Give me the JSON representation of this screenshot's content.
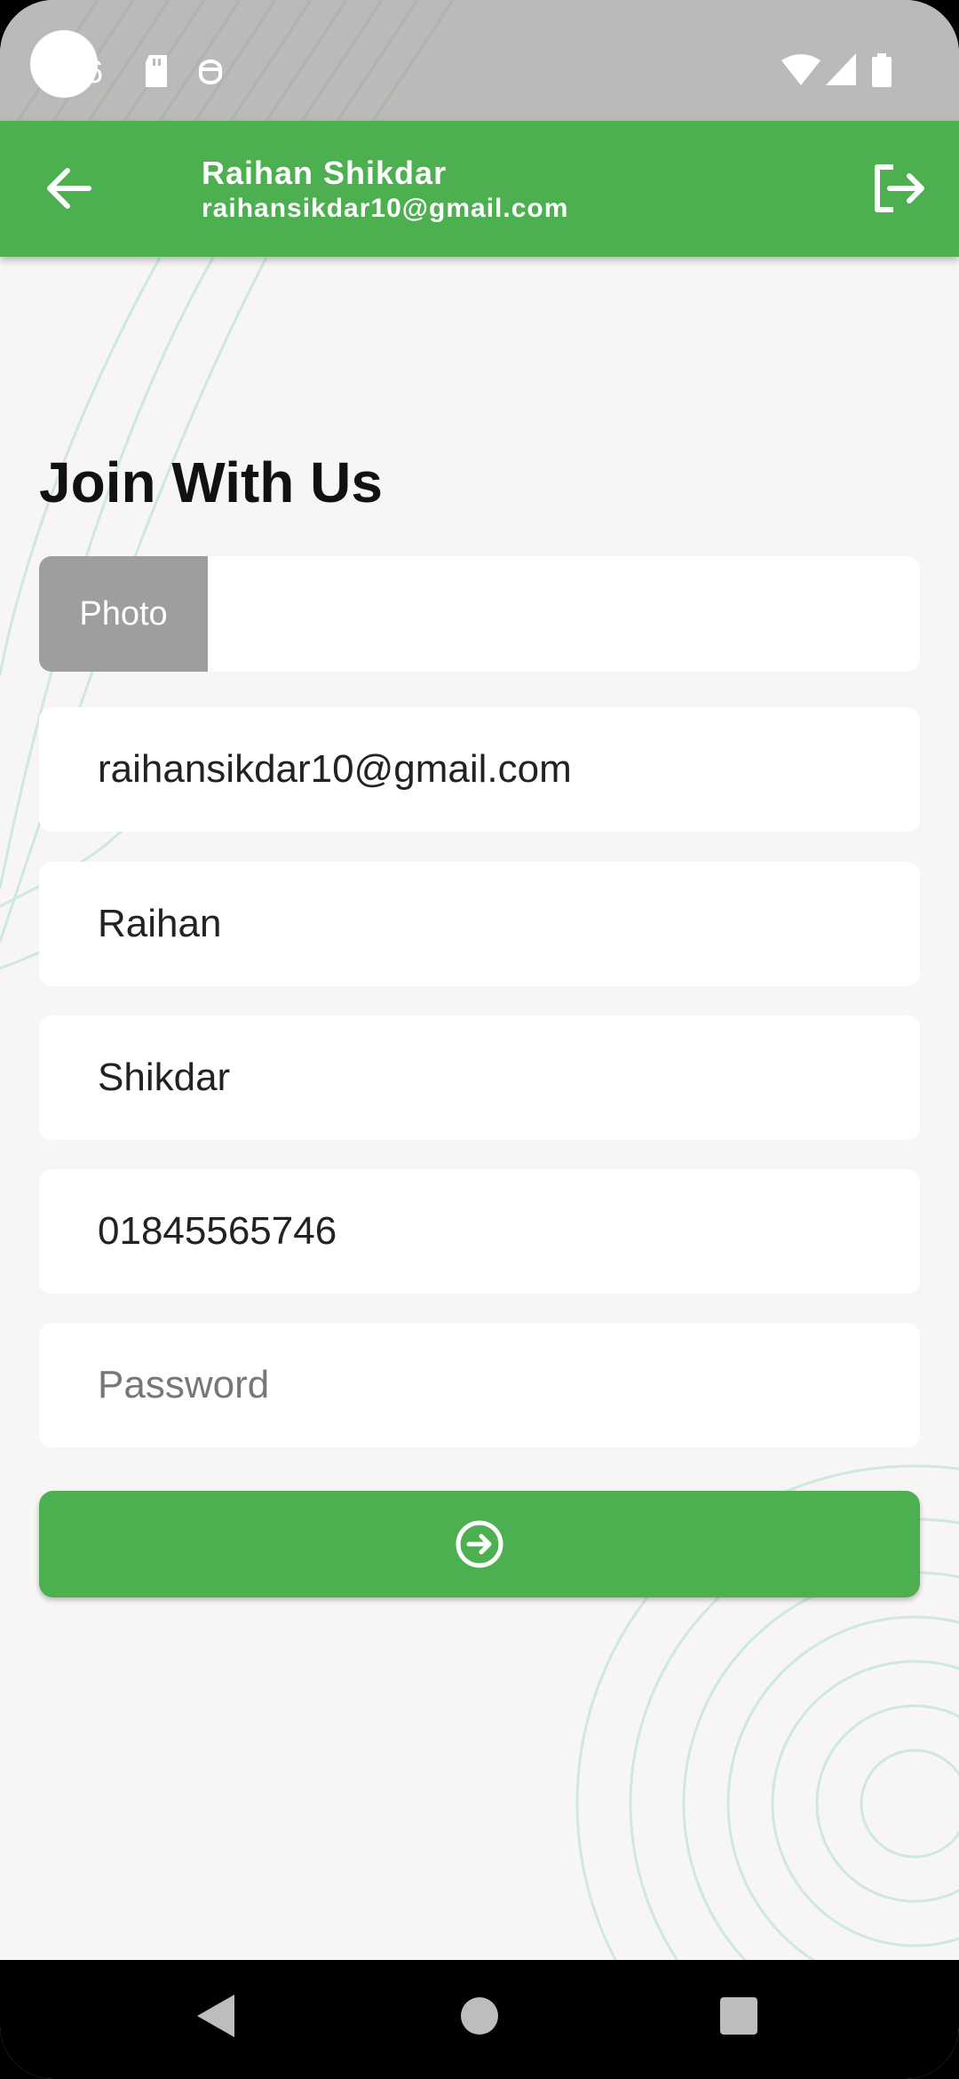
{
  "status_bar": {
    "time": "6",
    "icons": [
      "sd-card-icon",
      "face-icon",
      "wifi-icon",
      "signal-icon",
      "battery-icon"
    ]
  },
  "app_bar": {
    "name": "Raihan Shikdar",
    "email": "raihansikdar10@gmail.com",
    "back_icon": "arrow-left-icon",
    "logout_icon": "logout-icon"
  },
  "form": {
    "heading": "Join With Us",
    "photo_button_label": "Photo",
    "email_value": "raihansikdar10@gmail.com",
    "first_name_value": "Raihan",
    "last_name_value": "Shikdar",
    "phone_value": "01845565746",
    "password_placeholder": "Password",
    "submit_icon": "arrow-circle-right-icon"
  },
  "nav_bar": {
    "icons": [
      "back-triangle-icon",
      "home-circle-icon",
      "recents-square-icon"
    ]
  },
  "colors": {
    "primary": "#4caf50",
    "status_bar": "#bbbab8",
    "background": "#f7f6f4",
    "photo_button": "#9e9e9e"
  }
}
